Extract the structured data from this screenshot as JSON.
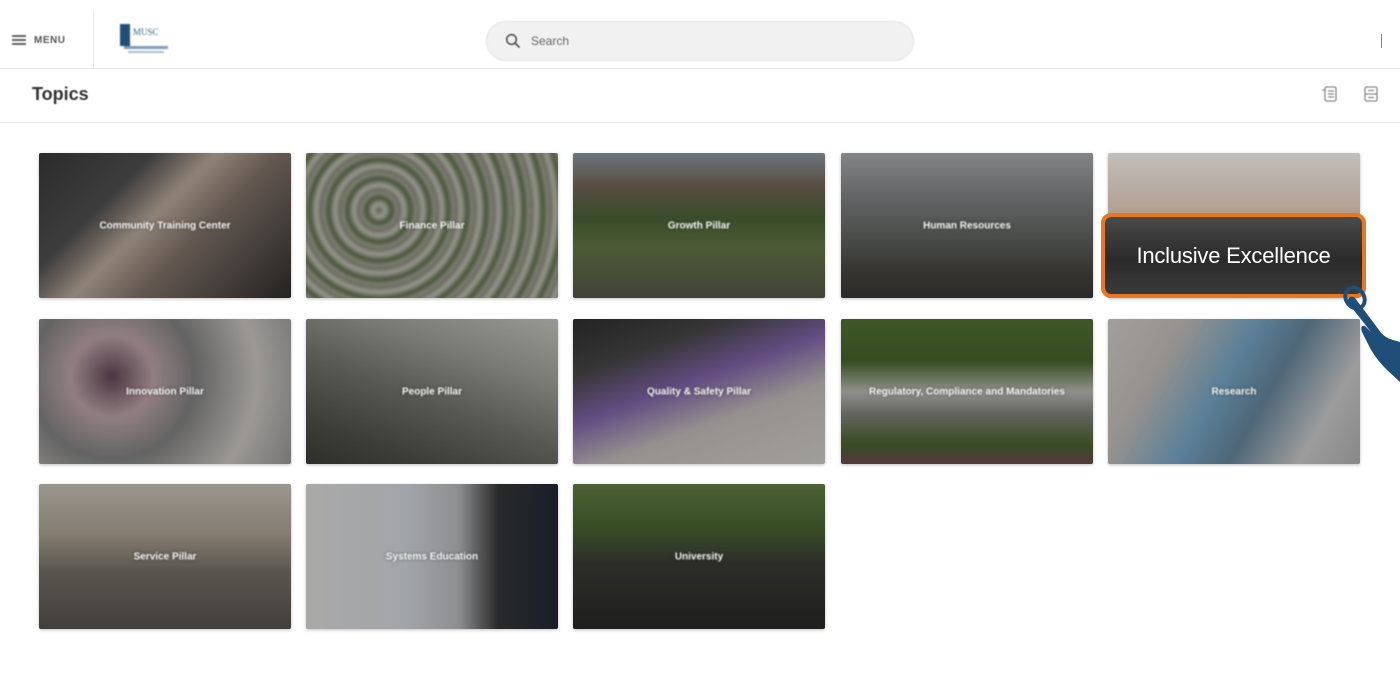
{
  "header": {
    "menu_label": "MENU",
    "logo_text": "MUSC",
    "search_placeholder": "Search"
  },
  "page": {
    "title": "Topics"
  },
  "topics": [
    {
      "label": "Community Training Center"
    },
    {
      "label": "Finance Pillar"
    },
    {
      "label": "Growth Pillar"
    },
    {
      "label": "Human Resources"
    },
    {
      "label": "Inclusive Excellence"
    },
    {
      "label": "Innovation Pillar"
    },
    {
      "label": "People Pillar"
    },
    {
      "label": "Quality & Safety Pillar"
    },
    {
      "label": "Regulatory, Compliance and Mandatories"
    },
    {
      "label": "Research"
    },
    {
      "label": "Service Pillar"
    },
    {
      "label": "Systems Education"
    },
    {
      "label": "University"
    }
  ],
  "highlight": {
    "label": "Inclusive Excellence",
    "border_color": "#e87722",
    "pointer_color": "#1f4e79"
  }
}
